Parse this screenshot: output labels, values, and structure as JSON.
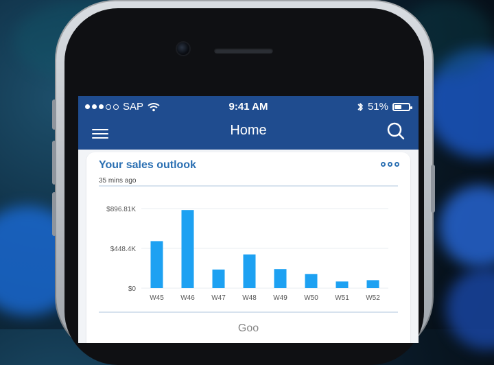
{
  "status_bar": {
    "carrier": "SAP",
    "time": "9:41 AM",
    "battery": "51%",
    "battery_level": 0.51
  },
  "nav": {
    "title": "Home"
  },
  "card": {
    "title": "Your sales outlook",
    "subtitle": "35 mins ago",
    "more_icon": "more-options-icon",
    "next_section_label": "Goo"
  },
  "chart_data": {
    "type": "bar",
    "categories": [
      "W45",
      "W46",
      "W47",
      "W48",
      "W49",
      "W50",
      "W51",
      "W52"
    ],
    "values": [
      530,
      880,
      210,
      380,
      215,
      160,
      75,
      90
    ],
    "y_ticks": [
      "$0",
      "$448.4K",
      "$896.81K"
    ],
    "ylim": [
      0,
      896.81
    ],
    "grid": true,
    "colors": {
      "bar": "#1da1f2",
      "grid": "#e9edf2",
      "axis_text": "#555555"
    }
  },
  "icons": {
    "menu": "hamburger-menu-icon",
    "search": "search-icon",
    "wifi": "wifi-icon",
    "bluetooth": "bluetooth-icon",
    "battery": "battery-icon"
  }
}
